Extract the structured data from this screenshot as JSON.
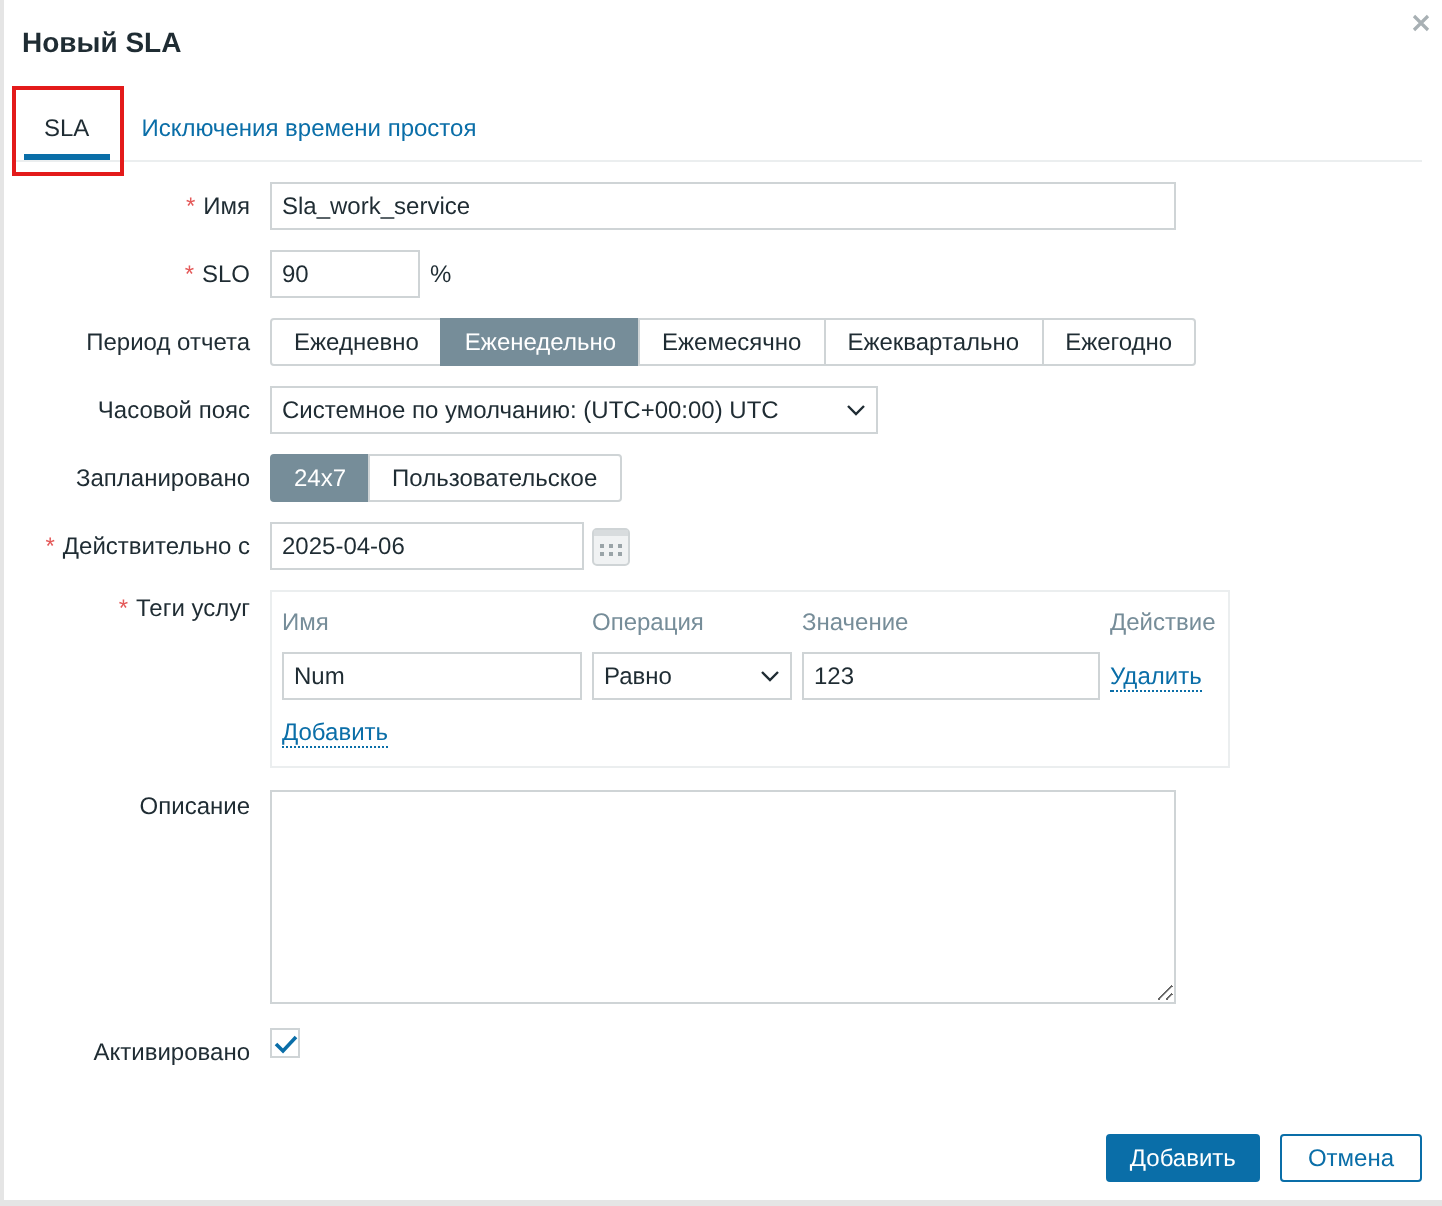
{
  "dialog": {
    "title": "Новый SLA"
  },
  "tabs": [
    {
      "label": "SLA",
      "selected": true,
      "highlighted": true
    },
    {
      "label": "Исключения времени простоя",
      "selected": false,
      "highlighted": false
    }
  ],
  "fields": [
    {
      "kind": "text",
      "label": "Имя",
      "required_mark": "*",
      "value": "Sla_work_service"
    },
    {
      "kind": "text",
      "label": "SLO",
      "required_mark": "*",
      "value": "90",
      "suffix": "%"
    },
    {
      "kind": "segmented",
      "label": "Период отчета",
      "options": [
        {
          "label": "Ежедневно",
          "selected": false
        },
        {
          "label": "Еженедельно",
          "selected": true
        },
        {
          "label": "Ежемесячно",
          "selected": false
        },
        {
          "label": "Ежеквартально",
          "selected": false
        },
        {
          "label": "Ежегодно",
          "selected": false
        }
      ]
    },
    {
      "kind": "select",
      "label": "Часовой пояс",
      "value": "Системное по умолчанию: (UTC+00:00) UTC"
    },
    {
      "kind": "segmented",
      "label": "Запланировано",
      "options": [
        {
          "label": "24x7",
          "selected": true
        },
        {
          "label": "Пользовательское",
          "selected": false
        }
      ]
    },
    {
      "kind": "date",
      "label": "Действительно с",
      "required_mark": "*",
      "value": "2025-04-06"
    },
    {
      "kind": "tags",
      "label": "Теги услуг",
      "required_mark": "*",
      "columns": [
        "Имя",
        "Операция",
        "Значение",
        "Действие"
      ],
      "rows": [
        {
          "name": "Num",
          "operation": "Равно",
          "value": "123",
          "action": "Удалить"
        }
      ],
      "add": "Добавить"
    },
    {
      "kind": "textarea",
      "label": "Описание"
    },
    {
      "kind": "checkbox",
      "label": "Активировано",
      "checked": true
    }
  ],
  "buttons": [
    {
      "label": "Добавить",
      "primary": true
    },
    {
      "label": "Отмена",
      "primary": false
    }
  ]
}
